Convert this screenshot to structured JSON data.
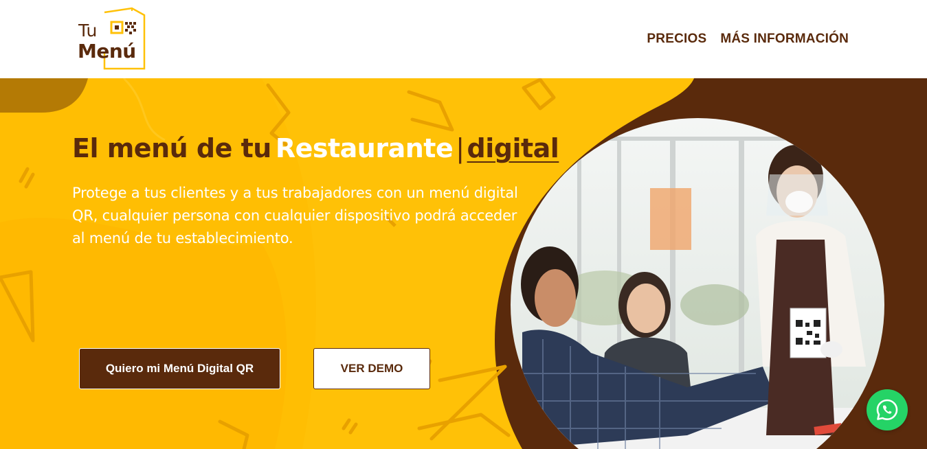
{
  "brand": {
    "logo_line1": "Tu",
    "logo_line2": "Menú"
  },
  "nav": {
    "items": [
      "PRECIOS",
      "MÁS INFORMACIÓN"
    ]
  },
  "hero": {
    "headline_part1": "El menú de tu",
    "headline_part2": "Restaurante",
    "headline_separator": "|",
    "headline_part3": "digital",
    "subtext": "Protege a tus clientes y a tus trabajadores con un menú digital QR, cualquier persona con cualquier dispositivo podrá acceder al menú de tu establecimiento.",
    "primary_button": "Quiero mi Menú Digital QR",
    "secondary_button": "VER DEMO",
    "image": "photo-waitress-showing-qr-code-to-customers"
  },
  "floating": {
    "chat_icon": "whatsapp-icon"
  },
  "colors": {
    "brand_brown": "#5a2a0c",
    "brand_yellow": "#ffc107",
    "whatsapp_green": "#25d366"
  }
}
